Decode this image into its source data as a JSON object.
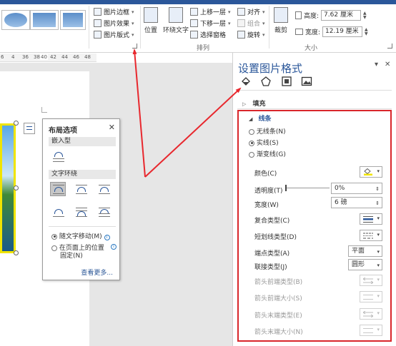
{
  "colors": {
    "accent": "#2b579a",
    "highlight_box": "#d9262b",
    "arrow": "#e8282e",
    "picture_border": "#f0e400",
    "link": "#2b5797"
  },
  "ribbon": {
    "picture_styles": {
      "border_label": "图片边框",
      "effects_label": "图片效果",
      "layout_label": "图片版式"
    },
    "arrange": {
      "position_label": "位置",
      "wrap_text_label": "环绕文字",
      "bring_forward_label": "上移一层",
      "send_backward_label": "下移一层",
      "selection_pane_label": "选择窗格",
      "align_label": "对齐",
      "group_label": "组合",
      "rotate_label": "旋转",
      "group_title": "排列"
    },
    "size": {
      "crop_label": "裁剪",
      "height_label": "高度:",
      "height_value": "7.62 厘米",
      "width_label": "宽度:",
      "width_value": "12.19 厘米",
      "group_title": "大小"
    }
  },
  "ruler": {
    "ticks": [
      "6",
      "4",
      "36",
      "38",
      "40",
      "42",
      "44",
      "46",
      "48"
    ]
  },
  "layout_popup": {
    "title": "布局选项",
    "close_icon": "close-icon",
    "inline_section": "嵌入型",
    "wrap_section": "文字环绕",
    "move_with_text": "随文字移动(M)",
    "fix_position_line1": "在页面上的位置",
    "fix_position_line2": "固定(N)",
    "see_more": "查看更多..."
  },
  "format_pane": {
    "title": "设置图片格式",
    "tabs": [
      "fill-line-icon",
      "effects-icon",
      "layout-properties-icon",
      "picture-icon"
    ],
    "fill_section": "填充",
    "line_section": "线条",
    "line_options": [
      "无线条(N)",
      "实线(S)",
      "渐变线(G)"
    ],
    "selected_line_option": "实线(S)",
    "properties": {
      "color_label": "颜色(C)",
      "transparency_label": "透明度(T)",
      "transparency_value": "0%",
      "width_label": "宽度(W)",
      "width_value": "6 磅",
      "compound_type_label": "复合类型(C)",
      "dash_type_label": "短划线类型(D)",
      "cap_type_label": "端点类型(A)",
      "cap_type_value": "平面",
      "join_type_label": "联接类型(J)",
      "join_type_value": "圆形",
      "begin_arrow_type_label": "箭头前端类型(B)",
      "begin_arrow_size_label": "箭头前端大小(S)",
      "end_arrow_type_label": "箭头末端类型(E)",
      "end_arrow_size_label": "箭头末端大小(N)"
    },
    "line_color": "#f0e400",
    "transparency": 0
  }
}
